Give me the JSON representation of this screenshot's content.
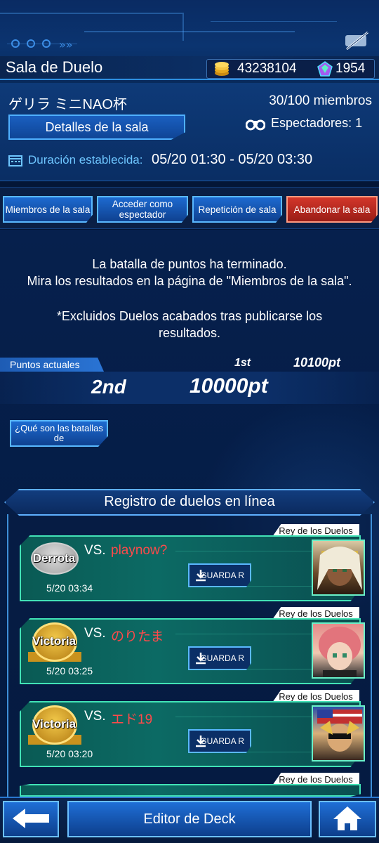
{
  "header": {
    "title": "Sala de Duelo",
    "gold": "43238104",
    "gems": "1954"
  },
  "room": {
    "name": "ゲリラ ミニNAO杯",
    "members": "30/100 miembros",
    "details_button": "Detalles de la sala",
    "spectators": "Espectadores: 1",
    "duration_label": "Duración establecida:",
    "duration_value": "05/20 01:30 - 05/20 03:30"
  },
  "actions": {
    "members": "Miembros de la sala",
    "spectate": "Acceder como espectador",
    "replay": "Repetición de sala",
    "leave": "Abandonar la sala"
  },
  "message": {
    "line1": "La batalla de puntos ha terminado.",
    "line2": "Mira los resultados en la página de \"Miembros de la sala\".",
    "line3": "*Excluidos Duelos acabados tras publicarse los",
    "line4": "resultados."
  },
  "points": {
    "label": "Puntos actuales",
    "first_rank": "1st",
    "first_points": "10100pt",
    "my_rank": "2nd",
    "my_points": "10000pt"
  },
  "help_button": "¿Qué son las batallas de",
  "log": {
    "title": "Registro de duelos en línea",
    "entries": [
      {
        "tag": "Rey de los Duelos",
        "result": "Derrota",
        "vs": "VS.",
        "opponent": "playnow?",
        "save": "GUARDA R",
        "date": "5/20 03:34"
      },
      {
        "tag": "Rey de los Duelos",
        "result": "Victoria",
        "vs": "VS.",
        "opponent": "のりたま",
        "save": "GUARDA R",
        "date": "5/20 03:25"
      },
      {
        "tag": "Rey de los Duelos",
        "result": "Victoria",
        "vs": "VS.",
        "opponent": "エド19",
        "save": "GUARDA R",
        "date": "5/20 03:20"
      },
      {
        "tag": "Rey de los Duelos"
      }
    ]
  },
  "bottom": {
    "editor": "Editor de Deck"
  },
  "colors": {
    "accent": "#5ab8ff",
    "opponent_name": "#ff4a4a",
    "leave_button": "#d3362a",
    "log_card_border": "#42e3b6"
  },
  "icons": [
    "mute-icon",
    "coin-icon",
    "gem-icon",
    "binoculars-icon",
    "calendar-icon",
    "download-icon",
    "back-arrow-icon",
    "home-icon"
  ]
}
